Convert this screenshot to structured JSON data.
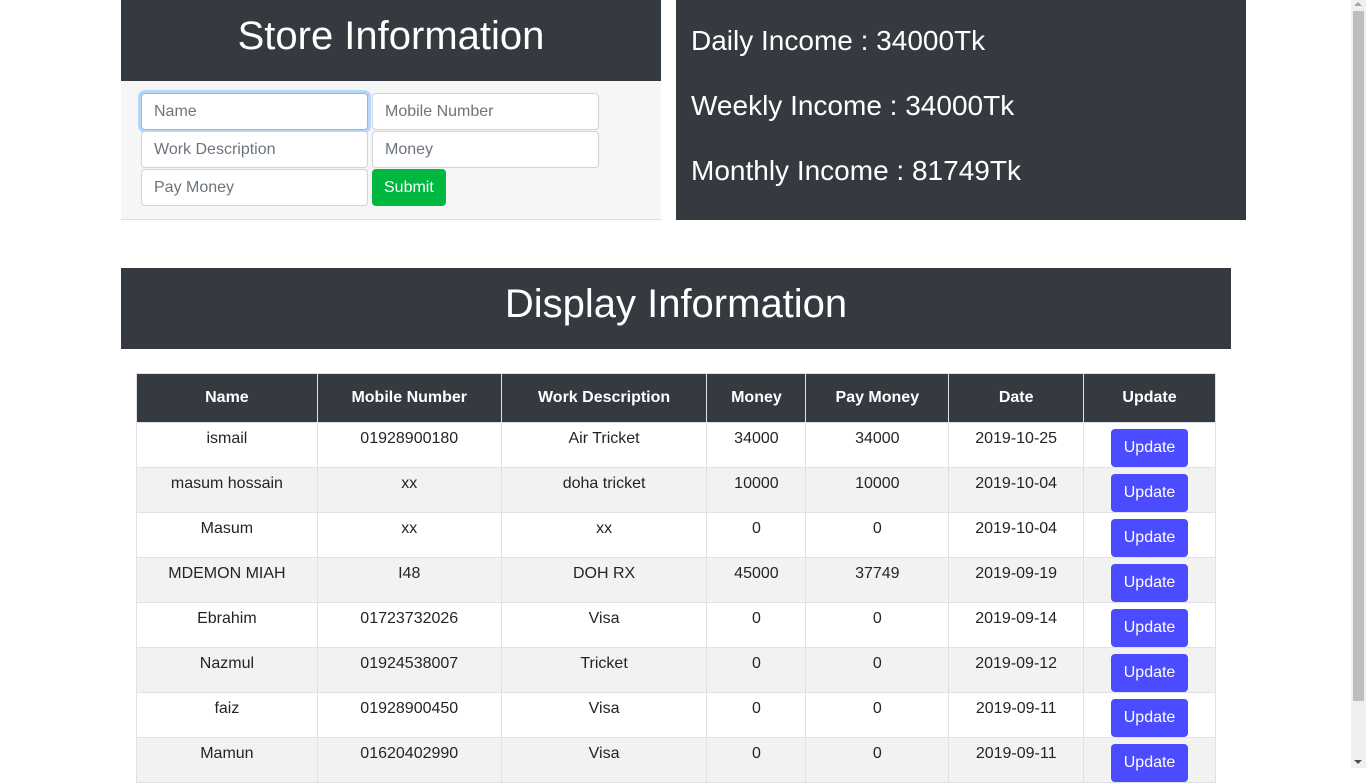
{
  "store": {
    "title": "Store Information",
    "fields": {
      "name": {
        "placeholder": "Name",
        "value": ""
      },
      "mobile": {
        "placeholder": "Mobile Number",
        "value": ""
      },
      "work_description": {
        "placeholder": "Work Description",
        "value": ""
      },
      "money": {
        "placeholder": "Money",
        "value": ""
      },
      "pay_money": {
        "placeholder": "Pay Money",
        "value": ""
      }
    },
    "submit_label": "Submit"
  },
  "income": {
    "daily": "Daily Income : 34000Tk",
    "weekly": "Weekly Income : 34000Tk",
    "monthly": "Monthly Income : 81749Tk"
  },
  "display": {
    "title": "Display Information",
    "columns": [
      "Name",
      "Mobile Number",
      "Work Description",
      "Money",
      "Pay Money",
      "Date",
      "Update"
    ],
    "update_label": "Update",
    "rows": [
      {
        "name": "ismail",
        "mobile": "01928900180",
        "work": "Air Tricket",
        "money": "34000",
        "pay": "34000",
        "date": "2019-10-25"
      },
      {
        "name": "masum hossain",
        "mobile": "xx",
        "work": "doha tricket",
        "money": "10000",
        "pay": "10000",
        "date": "2019-10-04"
      },
      {
        "name": "Masum",
        "mobile": "xx",
        "work": "xx",
        "money": "0",
        "pay": "0",
        "date": "2019-10-04"
      },
      {
        "name": "MDEMON MIAH",
        "mobile": "I48",
        "work": "DOH RX",
        "money": "45000",
        "pay": "37749",
        "date": "2019-09-19"
      },
      {
        "name": "Ebrahim",
        "mobile": "01723732026",
        "work": "Visa",
        "money": "0",
        "pay": "0",
        "date": "2019-09-14"
      },
      {
        "name": "Nazmul",
        "mobile": "01924538007",
        "work": "Tricket",
        "money": "0",
        "pay": "0",
        "date": "2019-09-12"
      },
      {
        "name": "faiz",
        "mobile": "01928900450",
        "work": "Visa",
        "money": "0",
        "pay": "0",
        "date": "2019-09-11"
      },
      {
        "name": "Mamun",
        "mobile": "01620402990",
        "work": "Visa",
        "money": "0",
        "pay": "0",
        "date": "2019-09-11"
      }
    ]
  },
  "colors": {
    "dark_header": "#343a40",
    "submit_green": "#00b840",
    "update_blue": "#4b4bff"
  }
}
